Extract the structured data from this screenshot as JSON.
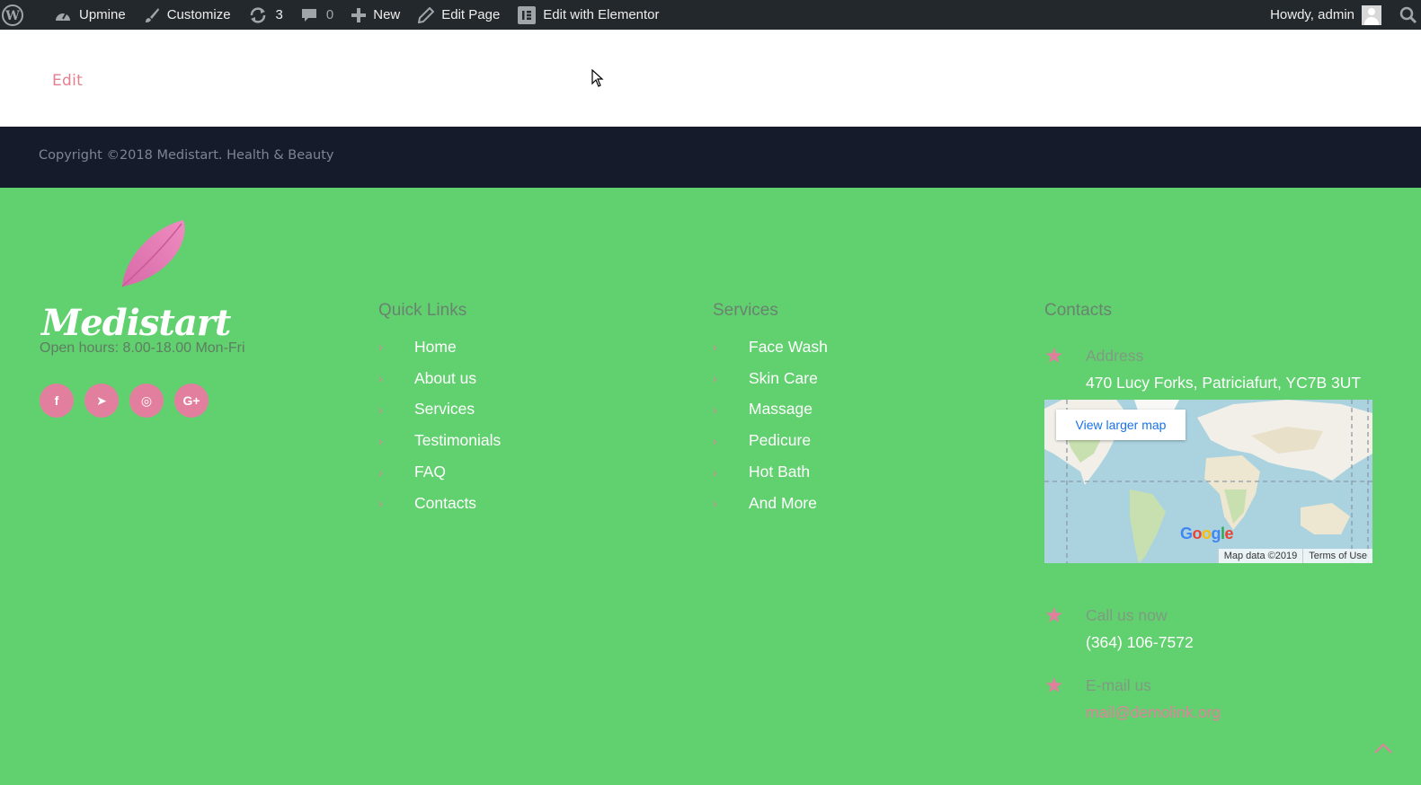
{
  "adminbar": {
    "site_name": "Upmine",
    "customize": "Customize",
    "updates_count": "3",
    "comments_count": "0",
    "new_label": "New",
    "edit_page": "Edit Page",
    "edit_elementor": "Edit with Elementor",
    "howdy": "Howdy, admin"
  },
  "edit_link": "Edit",
  "copyright": "Copyright ©2018 Medistart. Health & Beauty",
  "brand": {
    "name": "Medistart",
    "hours": "Open hours: 8.00-18.00 Mon-Fri"
  },
  "socials": [
    {
      "icon": "facebook-icon",
      "glyph": "f"
    },
    {
      "icon": "telegram-icon",
      "glyph": "➤"
    },
    {
      "icon": "instagram-icon",
      "glyph": "◎"
    },
    {
      "icon": "google-plus-icon",
      "glyph": "G+"
    }
  ],
  "quick_links": {
    "title": "Quick Links",
    "items": [
      "Home",
      "About us",
      "Services",
      "Testimonials",
      "FAQ",
      "Contacts"
    ]
  },
  "services": {
    "title": "Services",
    "items": [
      "Face Wash",
      "Skin Care",
      "Massage",
      "Pedicure",
      "Hot Bath",
      "And More"
    ]
  },
  "contacts": {
    "title": "Contacts",
    "address_label": "Address",
    "address_value": "470 Lucy Forks, Patriciafurt, YC7B 3UT",
    "call_label": "Call us now",
    "call_value": "(364) 106-7572",
    "email_label": "E-mail us",
    "email_value": "mail@demolink.org"
  },
  "map": {
    "view_larger": "View larger map",
    "google_mark": "Google",
    "map_data": "Map data ©2019",
    "terms": "Terms of Use"
  },
  "colors": {
    "accent_pink": "#e37f9e",
    "footer_green": "#61d06f",
    "copyright_bg": "#161b2c",
    "adminbar_bg": "#23282d"
  }
}
